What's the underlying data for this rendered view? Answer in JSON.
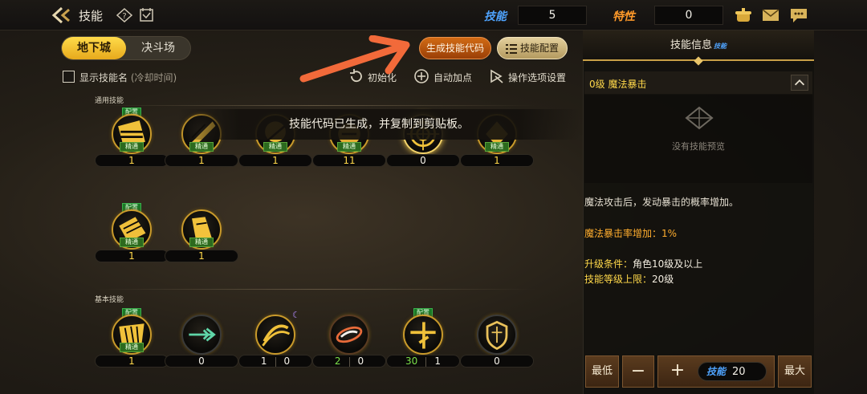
{
  "header": {
    "title": "技能",
    "stat_skill_label": "技能",
    "stat_skill_value": "5",
    "stat_trait_label": "特性",
    "stat_trait_value": "0"
  },
  "tabs": [
    {
      "label": "地下城",
      "active": true
    },
    {
      "label": "决斗场",
      "active": false
    }
  ],
  "actions": {
    "generate_code": "生成技能代码",
    "skill_config": "技能配置"
  },
  "options": {
    "show_name_label": "显示技能名",
    "show_name_sub": "(冷却时间)",
    "reset": "初始化",
    "auto_add": "自动加点",
    "settings": "操作选项设置"
  },
  "sections": {
    "common": "通用技能",
    "basic": "基本技能"
  },
  "badges": {
    "config": "配置",
    "master": "精通"
  },
  "skills_common_row1": [
    {
      "level": "1",
      "configured": true,
      "mastered": true
    },
    {
      "level": "1",
      "configured": false,
      "mastered": true
    },
    {
      "level": "1",
      "configured": false,
      "mastered": true
    },
    {
      "level": "11",
      "configured": false,
      "mastered": true
    },
    {
      "level": "0",
      "configured": false,
      "mastered": false
    },
    {
      "level": "1",
      "configured": false,
      "mastered": true
    }
  ],
  "skills_common_row2": [
    {
      "level": "1",
      "configured": true,
      "mastered": true
    },
    {
      "level": "1",
      "configured": false,
      "mastered": true
    }
  ],
  "skills_basic": [
    {
      "level": "1",
      "configured": true,
      "mastered": true
    },
    {
      "level": "0"
    },
    {
      "level_a": "1",
      "level_b": "0"
    },
    {
      "level_a": "2",
      "level_b": "0"
    },
    {
      "level_a": "30",
      "level_b": "1",
      "configured": true
    },
    {
      "level": "0"
    }
  ],
  "toast": "技能代码已生成，并复制到剪贴板。",
  "panel": {
    "header": "技能信息",
    "header_tag": "技能",
    "skill_name": "0级 魔法暴击",
    "no_preview": "没有技能预览",
    "description": "魔法攻击后，发动暴击的概率增加。",
    "effect": "魔法暴击率增加：1%",
    "req_label": "升级条件：",
    "req_value": "角色10级及以上",
    "cap_label": "技能等级上限：",
    "cap_value": "20级"
  },
  "controls": {
    "min": "最低",
    "minus": "−",
    "plus": "+",
    "level_label": "技能",
    "level_value": "20",
    "max": "最大"
  },
  "colors": {
    "accent_gold": "#ffd84a",
    "skill_blue": "#4fa4ff",
    "trait_orange": "#ff9a2a",
    "generate_button": "#c0570f",
    "arrow": "#f26a3a"
  }
}
